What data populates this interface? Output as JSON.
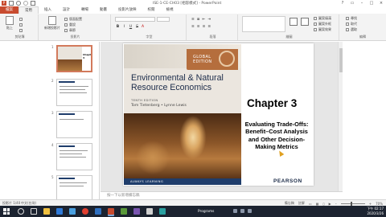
{
  "window": {
    "title": "ISE-1-CE-CH03 [相容模式] - PowerPoint",
    "logo": "P"
  },
  "ribbon_tabs": [
    "檔案",
    "常用",
    "插入",
    "設計",
    "轉場",
    "動畫",
    "投影片放映",
    "校閱",
    "檢視"
  ],
  "ribbon": {
    "clipboard_label": "剪貼簿",
    "paste_label": "貼上",
    "new_slide_label": "新增投影片",
    "layout_label": "版面配置",
    "reset_label": "重設",
    "section_label": "章節",
    "slides_label": "投影片",
    "font_label": "字型",
    "paragraph_label": "段落",
    "drawing_label": "繪圖",
    "arrange_label": "排列",
    "quick_styles_label": "快速樣式",
    "shape_fill_label": "圖案填滿",
    "shape_outline_label": "圖案外框",
    "shape_effects_label": "圖案效果",
    "find_label": "尋找",
    "replace_label": "取代",
    "select_label": "選取",
    "editing_label": "編輯"
  },
  "thumbnails": [
    {
      "num": "1",
      "kind": "cover",
      "ch": "Chapter 3"
    },
    {
      "num": "2",
      "kind": "text"
    },
    {
      "num": "3",
      "kind": "text"
    },
    {
      "num": "4",
      "kind": "text"
    },
    {
      "num": "5",
      "kind": "text"
    }
  ],
  "slide": {
    "badge_line1": "GLOBAL",
    "badge_line2": "EDITION",
    "book_title": "Environmental & Natural Resource Economics",
    "edition": "TENTH EDITION",
    "authors": "Tom Tietenberg • Lynne Lewis",
    "bottom_band": "ALWAYS LEARNING",
    "chapter": "Chapter 3",
    "subtitle": "Evaluating Trade-Offs: Benefit–Cost Analysis and Other Decision-Making Metrics",
    "publisher": "PEARSON"
  },
  "notes_placeholder": "按一下以新增備忘稿",
  "status": {
    "slide_info": "投影片 1/40",
    "language": "中文(台灣)",
    "notes": "備忘稿",
    "comments": "註解",
    "zoom": "70%"
  },
  "taskbar": {
    "program": "Programs",
    "time": "下午 02:17",
    "date": "2020/3/26"
  },
  "colors": {
    "brand": "#c84b2f",
    "book_navy": "#1c2c4a",
    "badge": "#b56e3d",
    "taskbar": "#1c2330"
  }
}
